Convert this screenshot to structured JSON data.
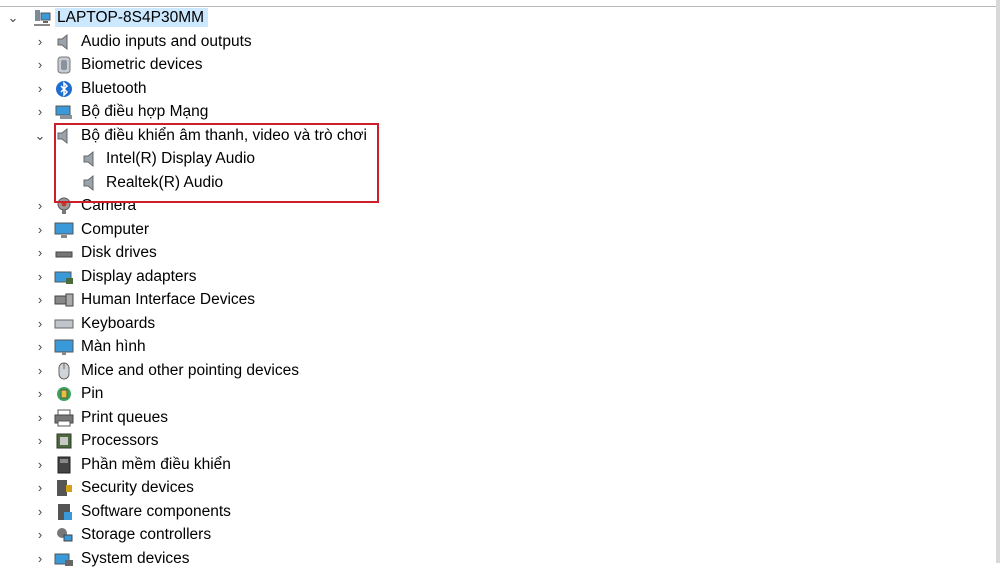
{
  "computer_name": "LAPTOP-8S4P30MM",
  "categories": [
    {
      "label": "Audio inputs and outputs",
      "icon": "speaker-icon",
      "expanded": false
    },
    {
      "label": "Biometric devices",
      "icon": "biometric-icon",
      "expanded": false
    },
    {
      "label": "Bluetooth",
      "icon": "bluetooth-icon",
      "expanded": false
    },
    {
      "label": "Bộ điều hợp Mạng",
      "icon": "network-adapter-icon",
      "expanded": false
    },
    {
      "label": "Bộ điều khiển âm thanh, video và trò chơi",
      "icon": "speaker-icon",
      "expanded": true,
      "children": [
        {
          "label": "Intel(R) Display Audio",
          "icon": "speaker-icon"
        },
        {
          "label": "Realtek(R) Audio",
          "icon": "speaker-icon"
        }
      ]
    },
    {
      "label": "Camera",
      "icon": "camera-icon",
      "expanded": false
    },
    {
      "label": "Computer",
      "icon": "computer-icon",
      "expanded": false
    },
    {
      "label": "Disk drives",
      "icon": "disk-drive-icon",
      "expanded": false
    },
    {
      "label": "Display adapters",
      "icon": "display-adapter-icon",
      "expanded": false
    },
    {
      "label": "Human Interface Devices",
      "icon": "hid-icon",
      "expanded": false
    },
    {
      "label": "Keyboards",
      "icon": "keyboard-icon",
      "expanded": false
    },
    {
      "label": "Màn hình",
      "icon": "monitor-icon",
      "expanded": false
    },
    {
      "label": "Mice and other pointing devices",
      "icon": "mouse-icon",
      "expanded": false
    },
    {
      "label": "Pin",
      "icon": "battery-icon",
      "expanded": false
    },
    {
      "label": "Print queues",
      "icon": "printer-icon",
      "expanded": false
    },
    {
      "label": "Processors",
      "icon": "processor-icon",
      "expanded": false
    },
    {
      "label": "Phần mềm điều khiển",
      "icon": "firmware-icon",
      "expanded": false
    },
    {
      "label": "Security devices",
      "icon": "security-device-icon",
      "expanded": false
    },
    {
      "label": "Software components",
      "icon": "software-component-icon",
      "expanded": false
    },
    {
      "label": "Storage controllers",
      "icon": "storage-controller-icon",
      "expanded": false
    },
    {
      "label": "System devices",
      "icon": "system-devices-icon",
      "expanded": false
    }
  ],
  "colors": {
    "selection": "#cce8ff",
    "highlight_border": "#cc1f2a"
  }
}
